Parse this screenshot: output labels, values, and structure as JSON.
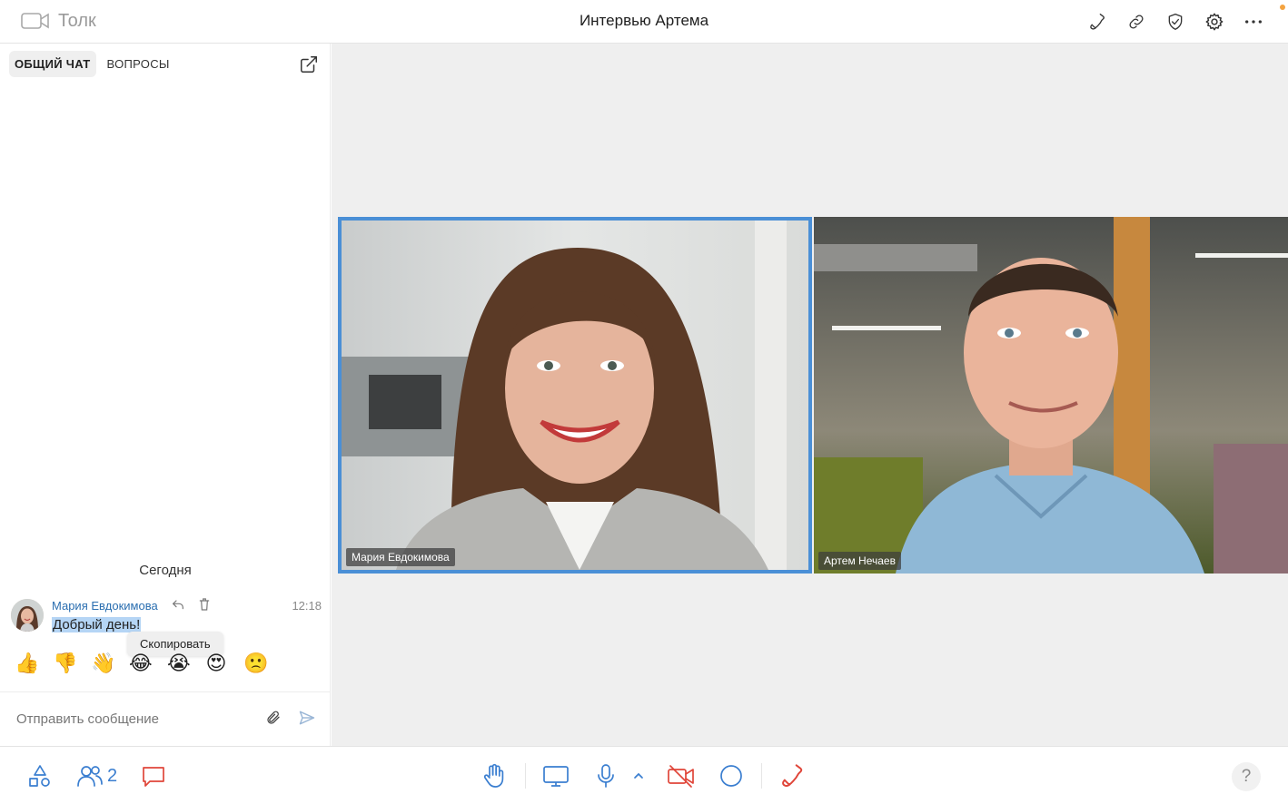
{
  "app": {
    "logo_name": "Толк",
    "title": "Интервью Артема"
  },
  "header_icons": [
    "phone-icon",
    "link-icon",
    "shield-check-icon",
    "gear-icon",
    "more-horizontal-icon"
  ],
  "chat": {
    "tabs": [
      {
        "label": "ОБЩИЙ ЧАТ",
        "active": true
      },
      {
        "label": "ВОПРОСЫ",
        "active": false
      }
    ],
    "day_separator": "Сегодня",
    "message": {
      "author": "Мария Евдокимова",
      "time": "12:18",
      "text": "Добрый день!"
    },
    "tooltip": "Скопировать",
    "reactions": [
      "👍",
      "👎",
      "👋",
      "😂",
      "😭",
      "😍",
      "🙁"
    ],
    "composer": {
      "placeholder": "Отправить сообщение",
      "value": ""
    }
  },
  "participants": [
    {
      "name": "Мария Евдокимова",
      "active_speaker": true
    },
    {
      "name": "Артем Нечаев",
      "active_speaker": false
    }
  ],
  "toolbar": {
    "participants_count": "2",
    "help_label": "?"
  },
  "colors": {
    "accent": "#3a7ed0",
    "active_speaker_border": "#4a8fd6",
    "danger": "#e0463a",
    "stage_background": "#efefef",
    "notification_dot": "#f4a340"
  }
}
